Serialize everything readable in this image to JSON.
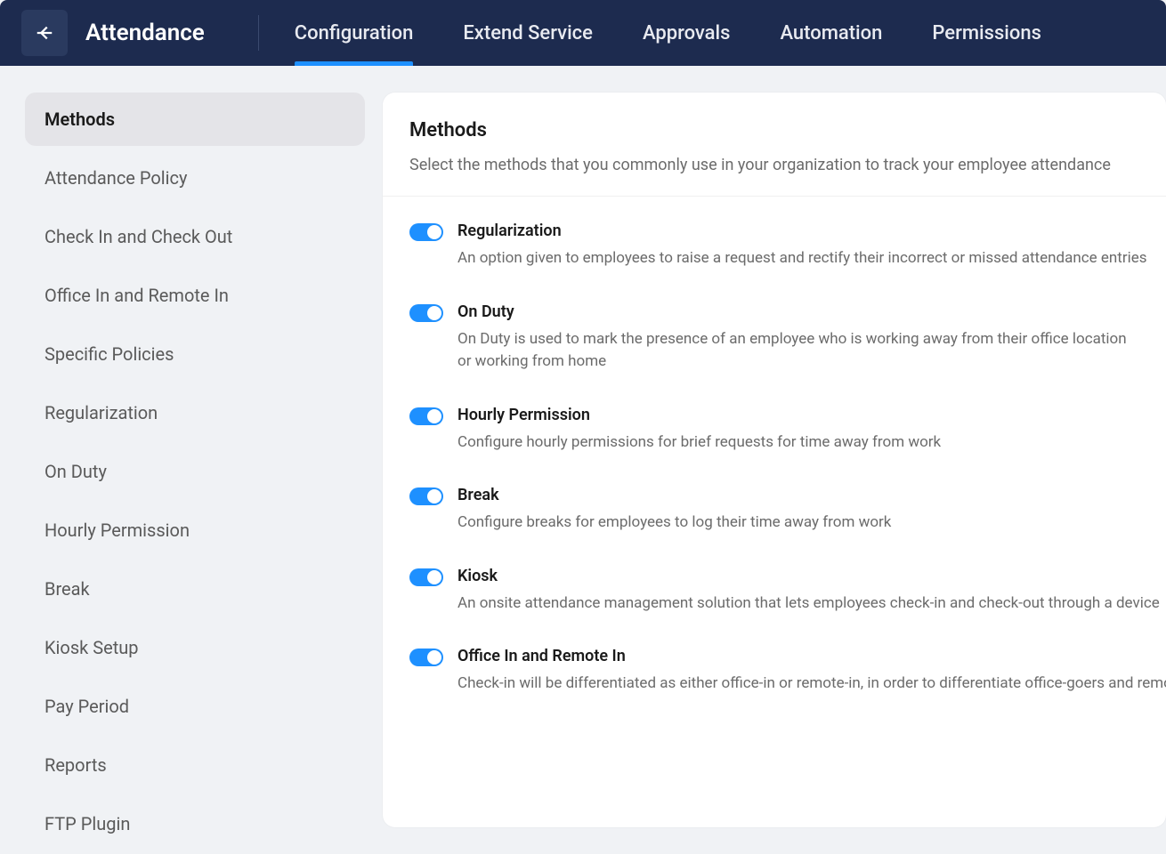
{
  "header": {
    "title": "Attendance",
    "tabs": [
      {
        "label": "Configuration",
        "active": true
      },
      {
        "label": "Extend Service",
        "active": false
      },
      {
        "label": "Approvals",
        "active": false
      },
      {
        "label": "Automation",
        "active": false
      },
      {
        "label": "Permissions",
        "active": false
      }
    ]
  },
  "sidebar": {
    "items": [
      {
        "label": "Methods",
        "active": true
      },
      {
        "label": "Attendance Policy",
        "active": false
      },
      {
        "label": "Check In and Check Out",
        "active": false
      },
      {
        "label": "Office In and Remote In",
        "active": false
      },
      {
        "label": "Specific Policies",
        "active": false
      },
      {
        "label": "Regularization",
        "active": false
      },
      {
        "label": "On Duty",
        "active": false
      },
      {
        "label": "Hourly Permission",
        "active": false
      },
      {
        "label": "Break",
        "active": false
      },
      {
        "label": "Kiosk Setup",
        "active": false
      },
      {
        "label": "Pay Period",
        "active": false
      },
      {
        "label": "Reports",
        "active": false
      },
      {
        "label": "FTP Plugin",
        "active": false
      }
    ]
  },
  "content": {
    "title": "Methods",
    "subtitle": "Select the methods that you commonly use in your organization to track your employee attendance",
    "methods": [
      {
        "title": "Regularization",
        "desc": "An option given to employees to raise a request and rectify their incorrect or missed attendance entries",
        "enabled": true
      },
      {
        "title": "On Duty",
        "desc": "On Duty is used to mark the presence of an employee who is working away from their office location or working from home",
        "enabled": true,
        "wrap": true
      },
      {
        "title": "Hourly Permission",
        "desc": "Configure hourly permissions for brief requests for time away from work",
        "enabled": true
      },
      {
        "title": "Break",
        "desc": "Configure breaks for employees to log their time away from work",
        "enabled": true
      },
      {
        "title": "Kiosk",
        "desc": "An onsite attendance management solution that lets employees check-in and check-out through a device",
        "enabled": true
      },
      {
        "title": "Office In and Remote In",
        "desc": "Check-in will be differentiated as either office-in or remote-in, in order to differentiate office-goers and remote workers",
        "enabled": true
      }
    ]
  }
}
